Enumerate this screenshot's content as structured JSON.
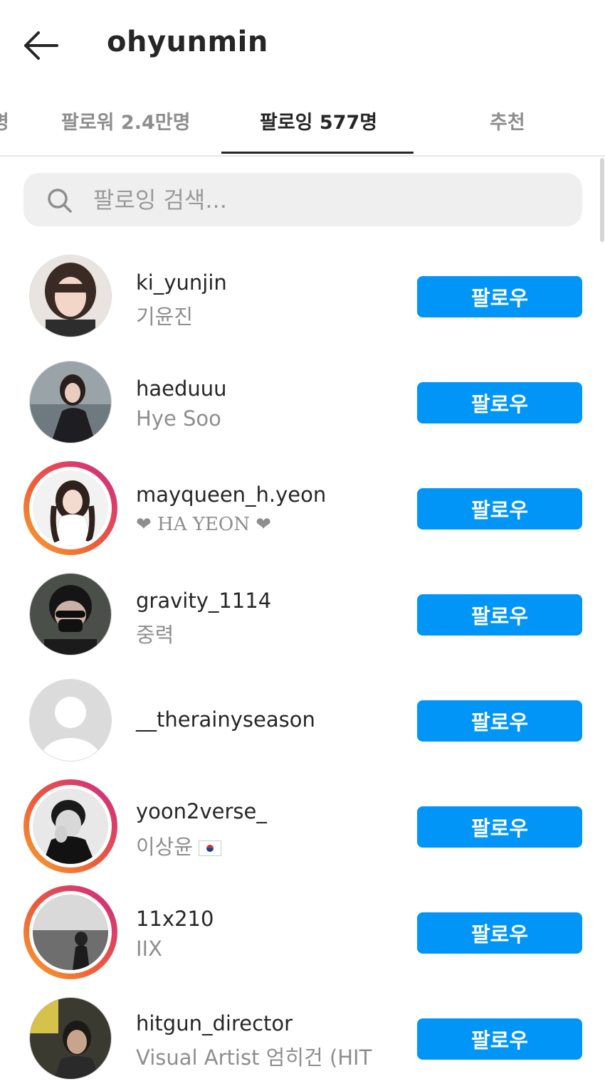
{
  "header": {
    "back_icon": "arrow-left-icon",
    "title": "ohyunmin"
  },
  "tabs": [
    {
      "label": "명"
    },
    {
      "label": "팔로워 2.4만명"
    },
    {
      "label": "팔로잉 577명",
      "active": true
    },
    {
      "label": "추천"
    }
  ],
  "search": {
    "icon": "search-icon",
    "placeholder": "팔로잉 검색..."
  },
  "follow_label": "팔로우",
  "colors": {
    "follow_button": "#0095f6",
    "secondary_text": "#8e8e8e",
    "search_bg": "#efefef"
  },
  "users": [
    {
      "handle": "ki_yunjin",
      "name": "기윤진",
      "story_ring": false
    },
    {
      "handle": "haeduuu",
      "name": "Hye Soo",
      "story_ring": false
    },
    {
      "handle": "mayqueen_h.yeon",
      "name": "❤ HA YEON ❤",
      "story_ring": true
    },
    {
      "handle": "gravity_1114",
      "name": "중력",
      "story_ring": false
    },
    {
      "handle": "__therainyseason",
      "name": "",
      "story_ring": false
    },
    {
      "handle": "yoon2verse_",
      "name": "이상윤",
      "story_ring": true
    },
    {
      "handle": "11x210",
      "name": "IIX",
      "story_ring": true
    },
    {
      "handle": "hitgun_director",
      "name": "Visual Artist 엄히건 (HIT",
      "story_ring": false
    }
  ]
}
